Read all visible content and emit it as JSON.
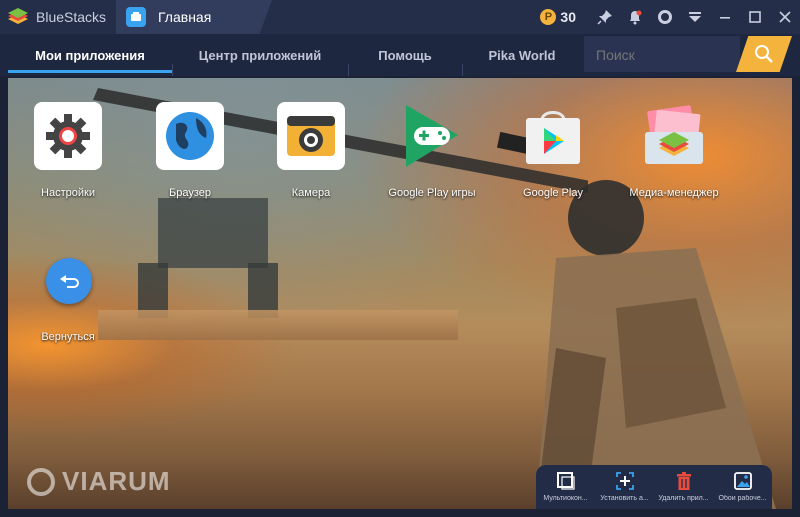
{
  "titlebar": {
    "brand": "BlueStacks",
    "tab_label": "Главная",
    "coins": "30"
  },
  "nav": {
    "tabs": [
      {
        "label": "Мои приложения"
      },
      {
        "label": "Центр приложений"
      },
      {
        "label": "Помощь"
      },
      {
        "label": "Pika World"
      }
    ],
    "search_placeholder": "Поиск"
  },
  "apps": [
    {
      "label": "Настройки",
      "icon": "gear-icon"
    },
    {
      "label": "Браузер",
      "icon": "globe-icon"
    },
    {
      "label": "Камера",
      "icon": "camera-icon"
    },
    {
      "label": "Google Play игры",
      "icon": "gamepad-icon"
    },
    {
      "label": "Google Play",
      "icon": "play-store-icon"
    },
    {
      "label": "Медиа-менеджер",
      "icon": "media-folder-icon"
    }
  ],
  "back": {
    "label": "Вернуться"
  },
  "watermark": "VIARUM",
  "bottom_bar": [
    {
      "label": "Мультиокон...",
      "icon": "multi-window-icon"
    },
    {
      "label": "Установить а...",
      "icon": "install-apk-icon"
    },
    {
      "label": "Удалить прил...",
      "icon": "trash-icon"
    },
    {
      "label": "Обои рабоче...",
      "icon": "wallpaper-icon"
    }
  ],
  "colors": {
    "accent": "#3aa3f0",
    "search_button": "#f3b33d",
    "titlebar": "#252e48",
    "navbar": "#1e2740"
  }
}
